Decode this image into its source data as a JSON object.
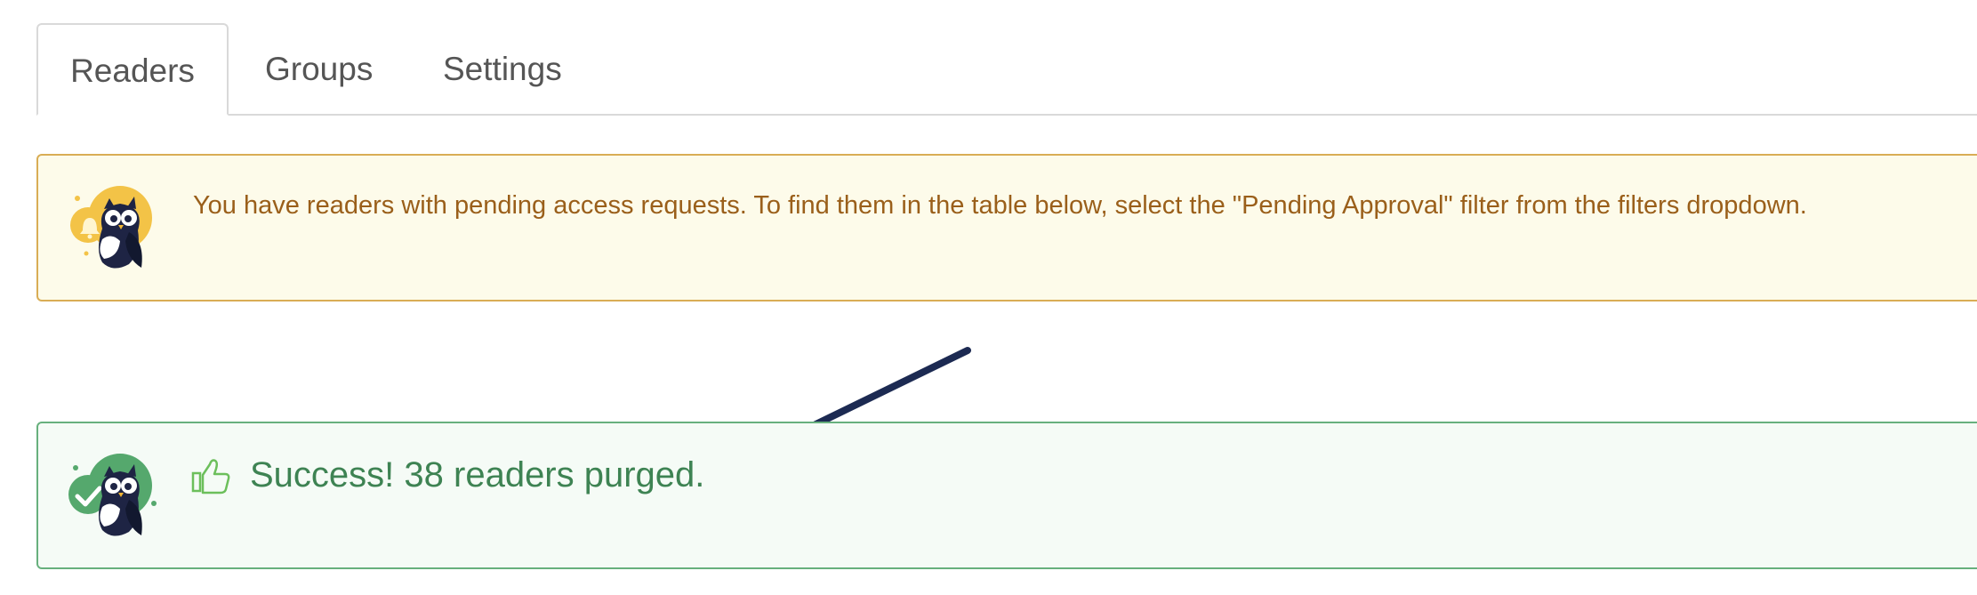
{
  "tabs": [
    {
      "label": "Readers",
      "active": true
    },
    {
      "label": "Groups",
      "active": false
    },
    {
      "label": "Settings",
      "active": false
    }
  ],
  "warning_alert": {
    "message": "You have readers with pending access requests. To find them in the table below, select the \"Pending Approval\" filter from the filters dropdown.",
    "icon": "owl-mascot-bell-icon",
    "color": "#9a5f1a"
  },
  "success_alert": {
    "message": "Success! 38 readers purged.",
    "icon": "owl-mascot-checkmark-icon",
    "inline_icon": "thumbs-up-icon",
    "color": "#3e8353"
  },
  "annotation": {
    "icon": "arrow-icon",
    "color": "#1c2a52"
  }
}
